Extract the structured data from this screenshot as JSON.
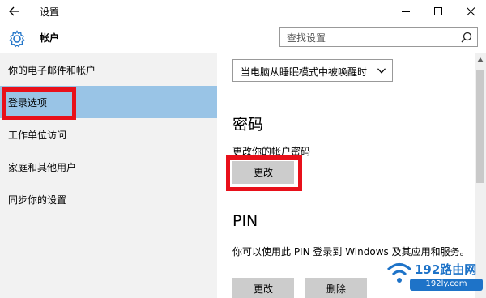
{
  "window": {
    "title": "设置",
    "controls": [
      "minimize-icon",
      "maximize-icon",
      "close-icon"
    ]
  },
  "header": {
    "icon": "gear-icon",
    "title": "帐户",
    "search_placeholder": "查找设置"
  },
  "sidebar": {
    "items": [
      {
        "label": "你的电子邮件和帐户",
        "selected": false
      },
      {
        "label": "登录选项",
        "selected": true
      },
      {
        "label": "工作单位访问",
        "selected": false
      },
      {
        "label": "家庭和其他用户",
        "selected": false
      },
      {
        "label": "同步你的设置",
        "selected": false
      }
    ]
  },
  "main": {
    "require_signin_dropdown": {
      "value": "当电脑从睡眠模式中被唤醒时"
    },
    "password": {
      "title": "密码",
      "description": "更改你的帐户密码",
      "change_button": "更改"
    },
    "pin": {
      "title": "PIN",
      "description": "你可以使用此 PIN 登录到 Windows 及其应用和服务。",
      "change_button": "更改",
      "delete_button": "删除"
    }
  },
  "watermark": {
    "logo_text": "192路由网",
    "url": "192ly.com"
  },
  "colors": {
    "selected_nav": "#99c4e6",
    "sidebar_bg": "#f2f2f2",
    "button_bg": "#cccccc",
    "highlight": "#e8101a",
    "watermark_blue": "#1e73c8"
  }
}
